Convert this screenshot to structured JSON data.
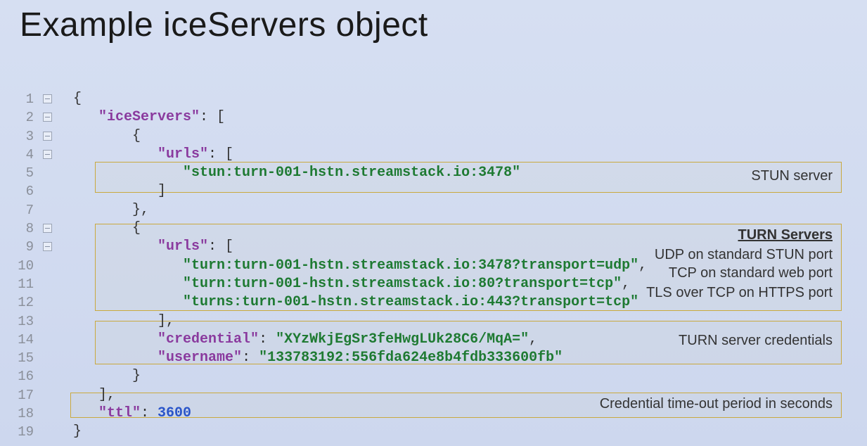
{
  "title": "Example iceServers object",
  "gutter": {
    "first": 1,
    "last": 19
  },
  "code": {
    "l1": "{",
    "l2_key": "\"iceServers\"",
    "l2_after": ": [",
    "l3": "{",
    "l4_key": "\"urls\"",
    "l4_after": ": [",
    "l5_val": "\"stun:turn-001-hstn.streamstack.io:3478\"",
    "l6": "]",
    "l7": "},",
    "l8": "{",
    "l9_key": "\"urls\"",
    "l9_after": ": [",
    "l10_val": "\"turn:turn-001-hstn.streamstack.io:3478?transport=udp\"",
    "l10_comma": ",",
    "l11_val": "\"turn:turn-001-hstn.streamstack.io:80?transport=tcp\"",
    "l11_comma": ",",
    "l12_val": "\"turns:turn-001-hstn.streamstack.io:443?transport=tcp\"",
    "l13": "],",
    "l14_key": "\"credential\"",
    "l14_mid": ": ",
    "l14_val": "\"XYzWkjEgSr3feHwgLUk28C6/MqA=\"",
    "l14_comma": ",",
    "l15_key": "\"username\"",
    "l15_mid": ": ",
    "l15_val": "\"133783192:556fda624e8b4fdb333600fb\"",
    "l16": "}",
    "l17": "],",
    "l18_key": "\"ttl\"",
    "l18_mid": ": ",
    "l18_val": "3600",
    "l19": "}"
  },
  "annotations": {
    "stun": "STUN server",
    "turn_header": "TURN Servers",
    "turn_udp": "UDP on standard STUN port",
    "turn_tcp": "TCP on standard web port",
    "turn_tls": "TLS over TCP on HTTPS port",
    "cred": "TURN server credentials",
    "ttl": "Credential time-out period in seconds"
  }
}
